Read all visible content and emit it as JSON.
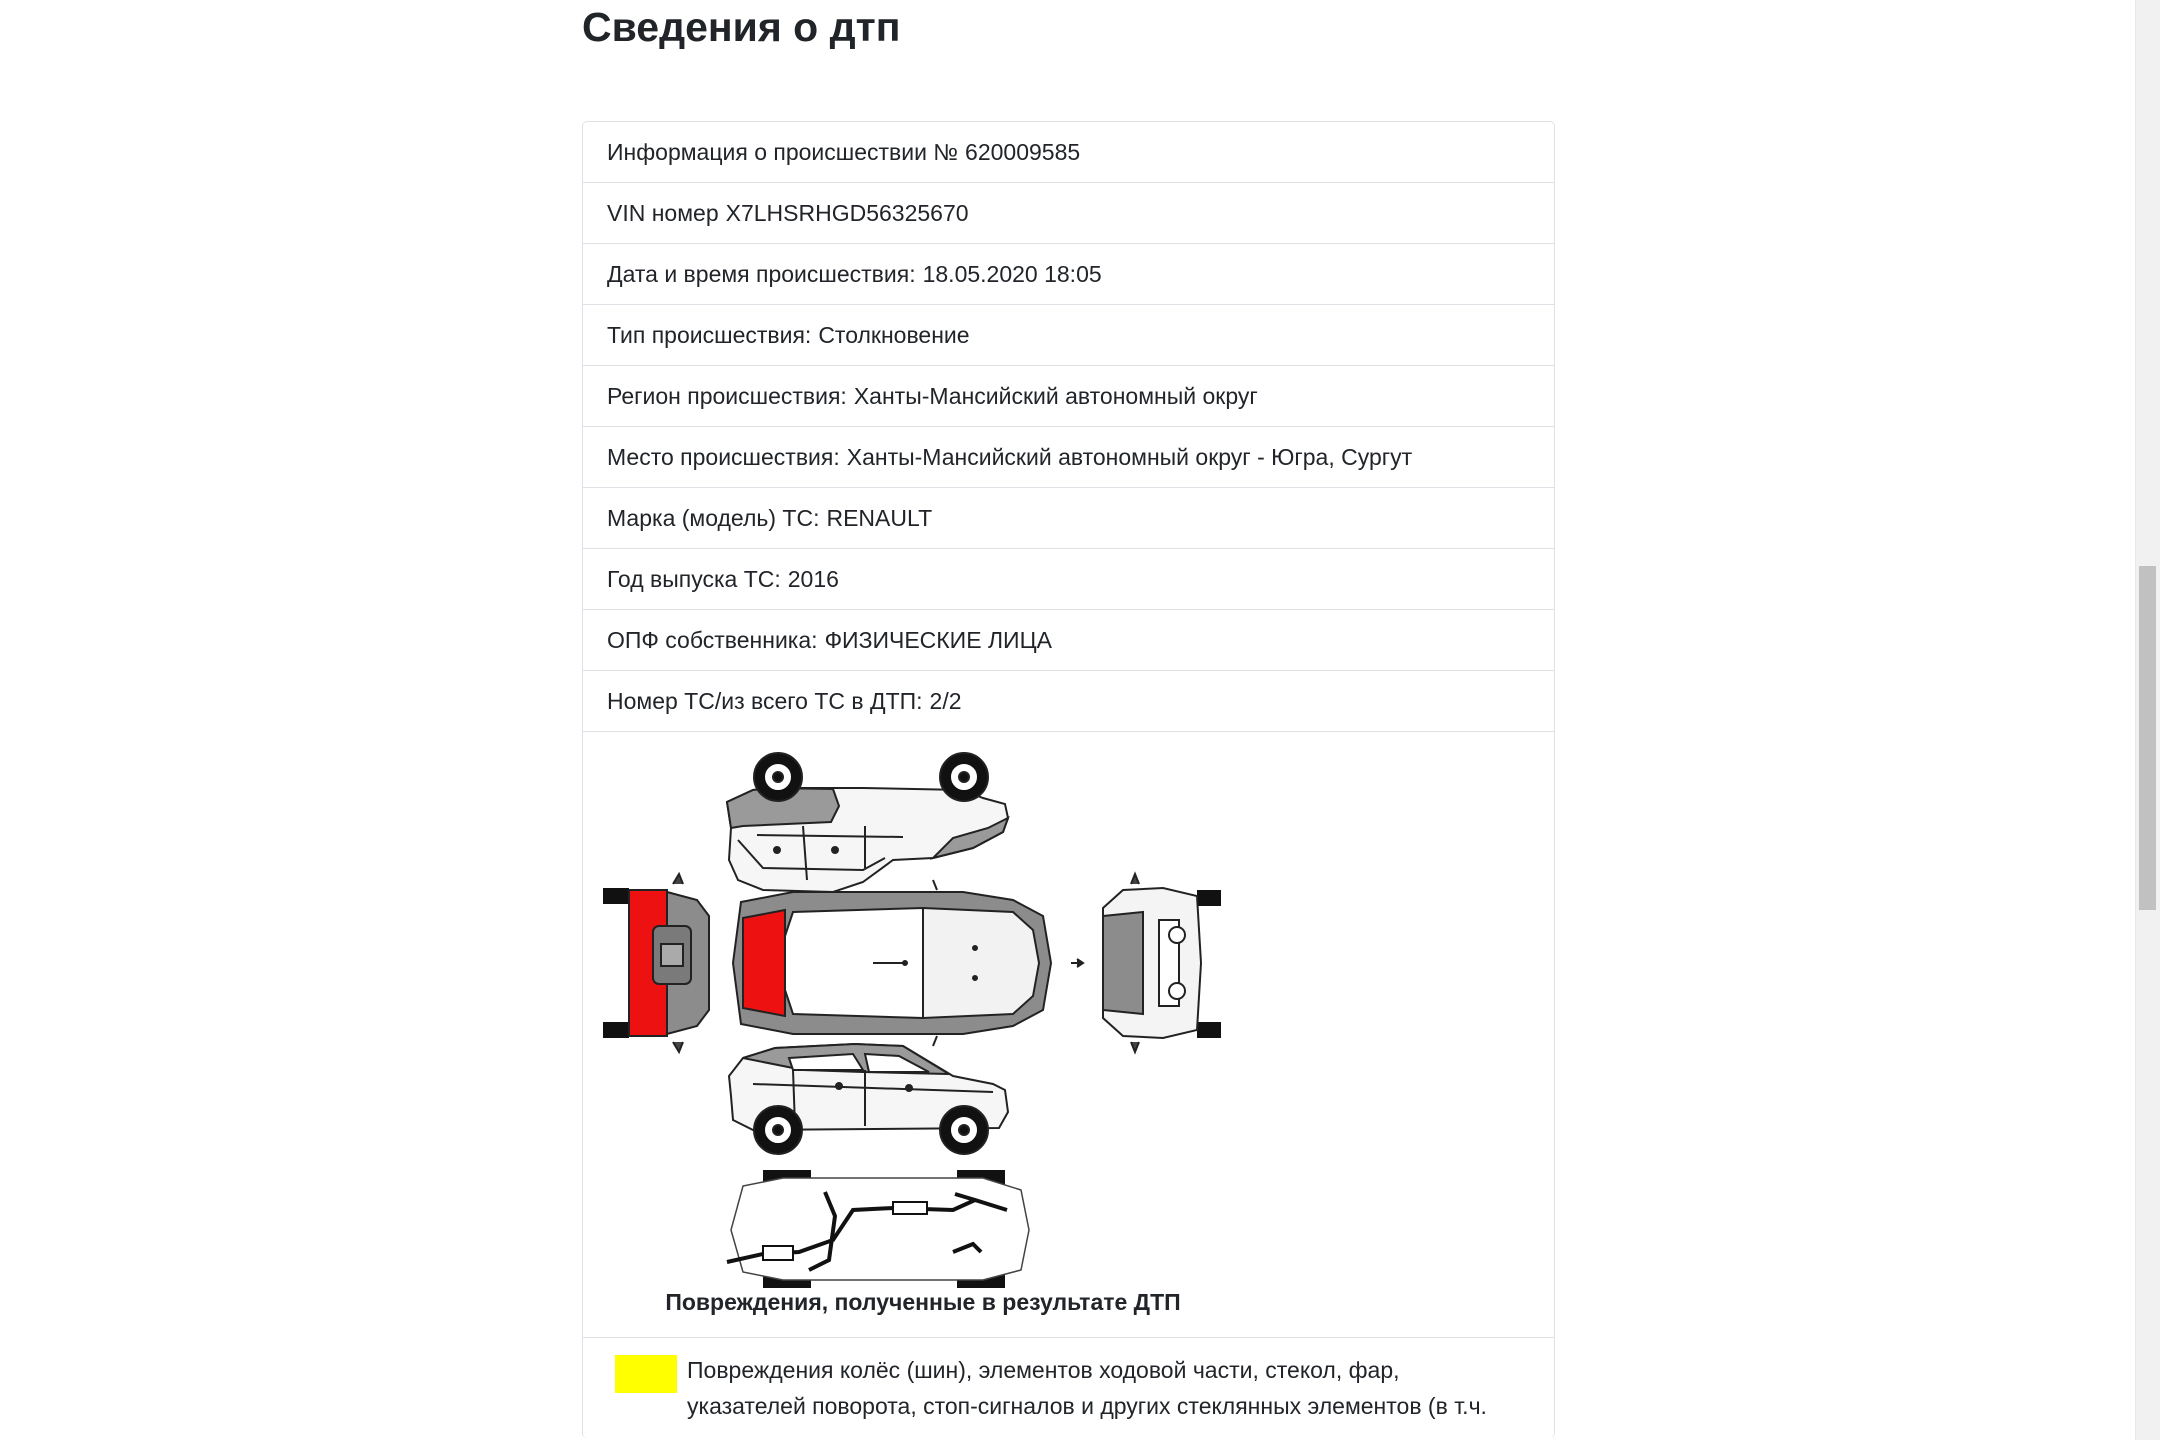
{
  "page_title": "Сведения о дтп",
  "accident_info": [
    {
      "label": "Информация о происшествии №",
      "value": "620009585"
    },
    {
      "label": "VIN номер",
      "value": "X7LHSRHGD56325670"
    },
    {
      "label": "Дата и время происшествия:",
      "value": "18.05.2020 18:05"
    },
    {
      "label": "Тип происшествия:",
      "value": "Столкновение"
    },
    {
      "label": "Регион происшествия:",
      "value": "Ханты-Мансийский автономный округ"
    },
    {
      "label": "Место происшествия:",
      "value": "Ханты-Мансийский автономный округ - Югра, Сургут"
    },
    {
      "label": "Марка (модель) ТС:",
      "value": "RENAULT"
    },
    {
      "label": "Год выпуска ТС:",
      "value": "2016"
    },
    {
      "label": "ОПФ собственника:",
      "value": "ФИЗИЧЕСКИЕ ЛИЦА"
    },
    {
      "label": "Номер ТС/из всего ТС в ДТП:",
      "value": "2/2"
    }
  ],
  "damage_diagram": {
    "caption": "Повреждения, полученные в результате ДТП",
    "damaged_zone_color": "#ee1111",
    "damaged_zones": [
      "rear-bumper",
      "rear-panel",
      "trunk-lid"
    ]
  },
  "legend": [
    {
      "color": "#ffff00",
      "text": "Повреждения колёс (шин), элементов ходовой части, стекол, фар, указателей поворота, стоп-сигналов и других стеклянных элементов (в т.ч."
    }
  ]
}
